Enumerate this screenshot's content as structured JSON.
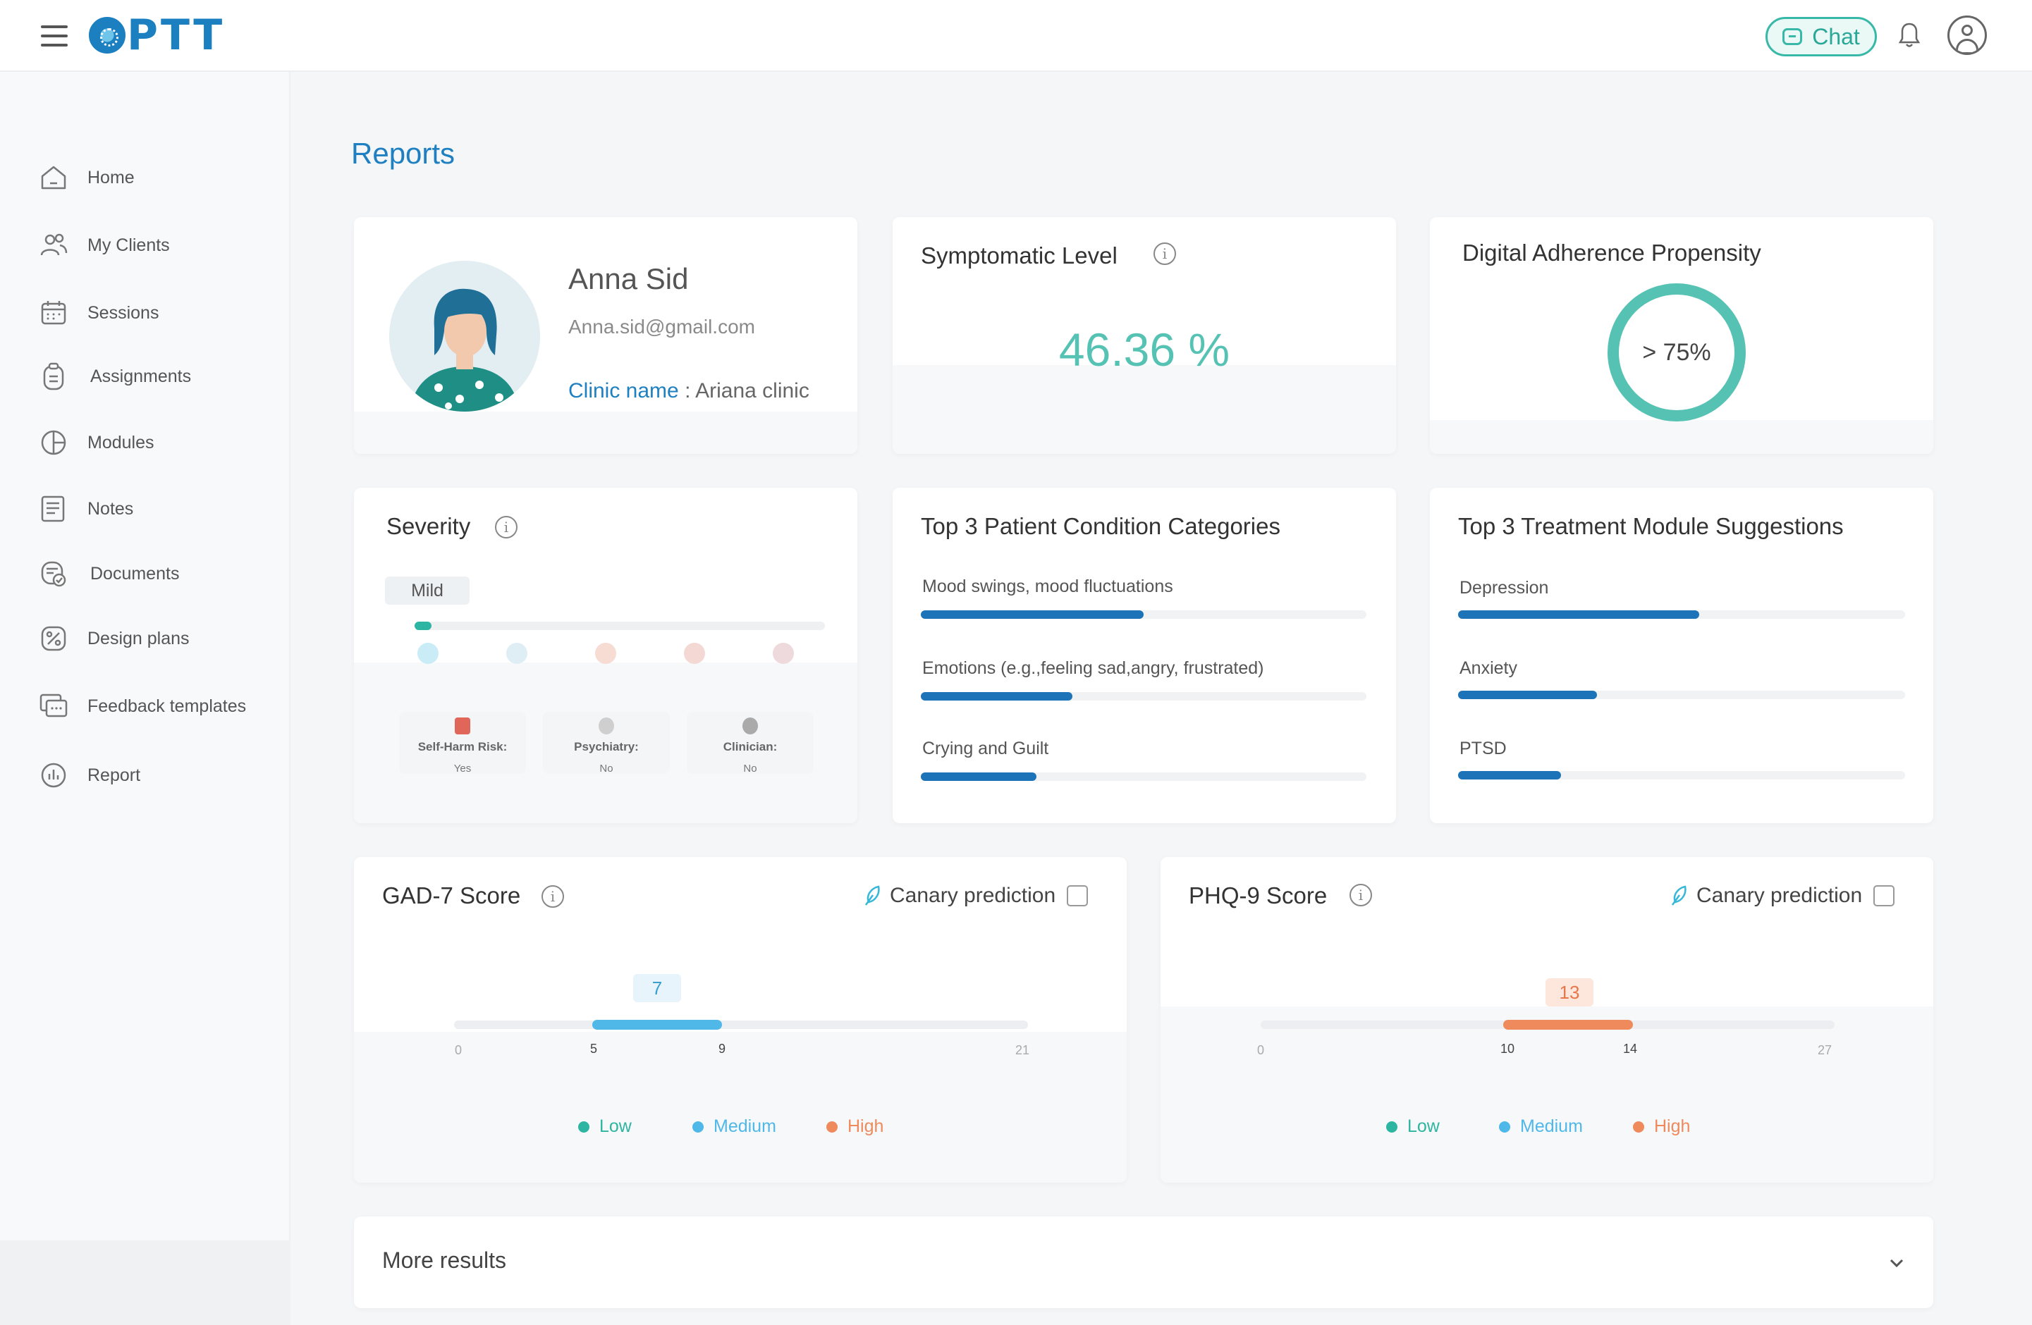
{
  "header": {
    "logo_text": "PTT",
    "chat_label": "Chat"
  },
  "sidebar": {
    "items": [
      {
        "label": "Home",
        "icon": "home-icon"
      },
      {
        "label": "My Clients",
        "icon": "clients-icon"
      },
      {
        "label": "Sessions",
        "icon": "calendar-icon"
      },
      {
        "label": "Assignments",
        "icon": "clipboard-icon"
      },
      {
        "label": "Modules",
        "icon": "modules-icon"
      },
      {
        "label": "Notes",
        "icon": "notes-icon"
      },
      {
        "label": "Documents",
        "icon": "documents-icon"
      },
      {
        "label": "Design plans",
        "icon": "design-plans-icon"
      },
      {
        "label": "Feedback templates",
        "icon": "feedback-icon"
      },
      {
        "label": "Report",
        "icon": "report-icon"
      }
    ]
  },
  "main": {
    "title": "Reports",
    "profile": {
      "name": "Anna Sid",
      "email": "Anna.sid@gmail.com",
      "clinic_key": "Clinic name",
      "clinic_sep": " : ",
      "clinic_value": "Ariana clinic"
    },
    "symptomatic": {
      "title": "Symptomatic Level",
      "value": "46.36 %"
    },
    "adherence": {
      "title": "Digital Adherence Propensity",
      "value": "> 75%"
    },
    "severity": {
      "title": "Severity",
      "level": "Mild",
      "level_fraction": 0.03,
      "flags": [
        {
          "label": "Self-Harm Risk:",
          "value": "Yes",
          "icon": "lock-icon",
          "color": "#e0665a"
        },
        {
          "label": "Psychiatry:",
          "value": "No",
          "icon": "brain-icon",
          "color": "#bbbbbb"
        },
        {
          "label": "Clinician:",
          "value": "No",
          "icon": "plus-icon",
          "color": "#aaaaaa"
        }
      ]
    },
    "conditions": {
      "title": "Top 3 Patient Condition Categories",
      "items": [
        {
          "label": "Mood swings, mood fluctuations",
          "fraction": 0.5
        },
        {
          "label": "Emotions (e.g.,feeling sad,angry, frustrated)",
          "fraction": 0.34
        },
        {
          "label": "Crying and Guilt",
          "fraction": 0.26
        }
      ]
    },
    "modules": {
      "title": "Top 3 Treatment Module Suggestions",
      "items": [
        {
          "label": "Depression",
          "fraction": 0.54
        },
        {
          "label": "Anxiety",
          "fraction": 0.31
        },
        {
          "label": "PTSD",
          "fraction": 0.23
        }
      ]
    },
    "gad7": {
      "title": "GAD-7 Score",
      "canary_label": "Canary prediction",
      "score": "7",
      "range_low": "5",
      "range_high": "9",
      "min": "0",
      "max": "21",
      "accent": "#4fb8e8"
    },
    "phq9": {
      "title": "PHQ-9 Score",
      "canary_label": "Canary prediction",
      "score": "13",
      "range_low": "10",
      "range_high": "14",
      "min": "0",
      "max": "27",
      "accent": "#ef8a5c"
    },
    "legend": [
      {
        "label": "Low",
        "color": "#2eb5a1"
      },
      {
        "label": "Medium",
        "color": "#4fb8e8"
      },
      {
        "label": "High",
        "color": "#ef8a5c"
      }
    ],
    "more_results": "More results"
  }
}
